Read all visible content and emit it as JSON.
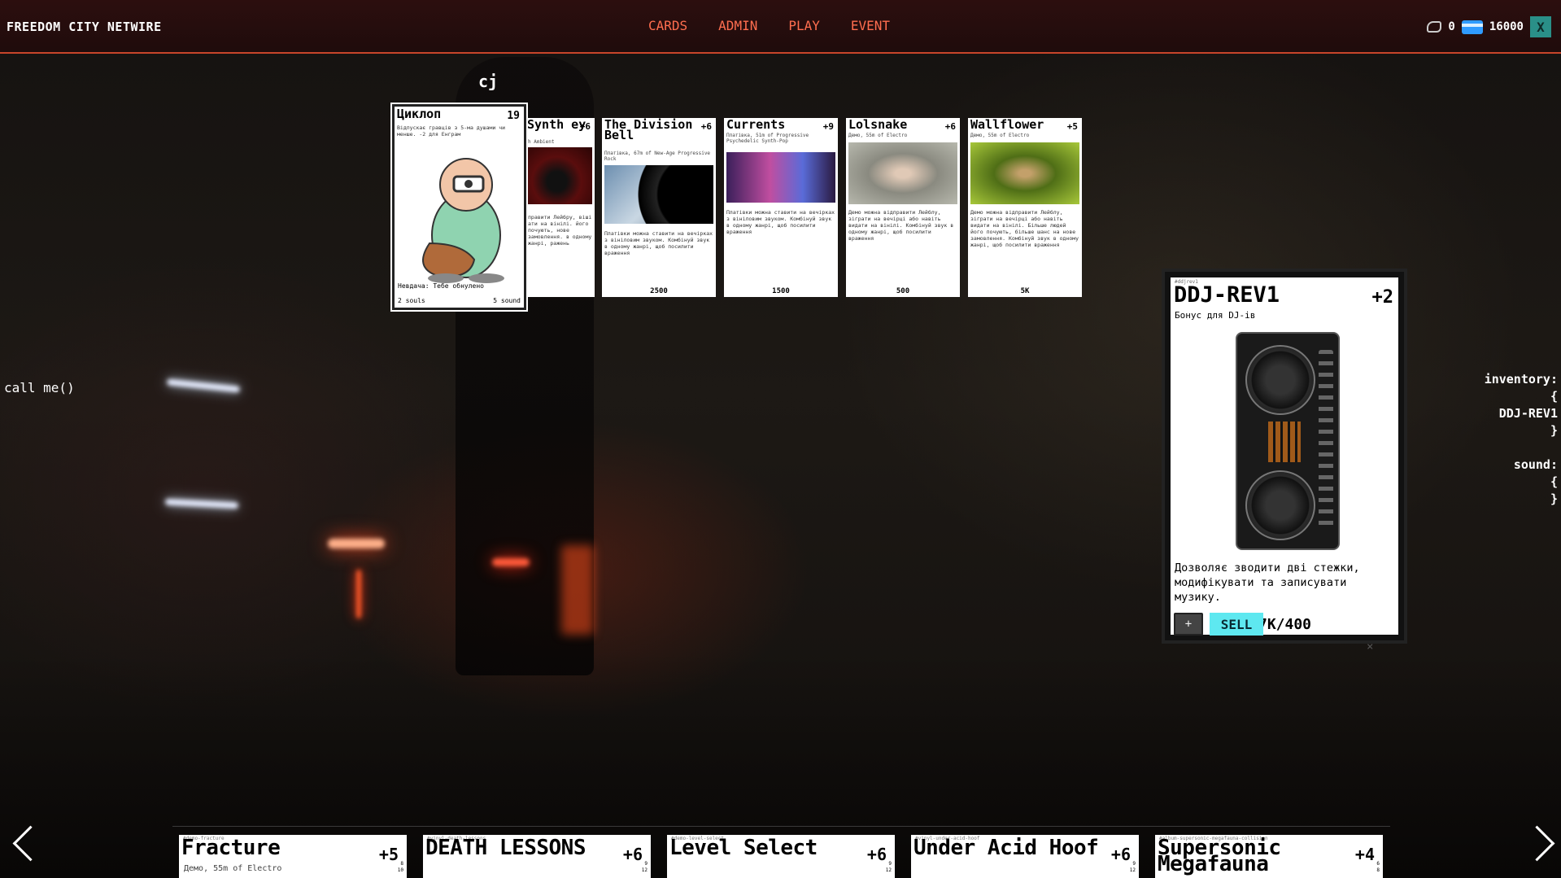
{
  "header": {
    "brand": "FREEDOM CITY NETWIRE",
    "nav": [
      "CARDS",
      "ADMIN",
      "PLAY",
      "EVENT"
    ],
    "hand_count": "0",
    "credits": "16000",
    "close_label": "X"
  },
  "player": {
    "name": "cj"
  },
  "hand": [
    {
      "title": "Циклоп",
      "power": "19",
      "desc": "Відпускає гравців з 5-ма душами чи менше. -2 для Енграм",
      "note": "Невдача: Тебе обнулено",
      "souls": "2 souls",
      "sound": "5 sound"
    },
    {
      "title": "Synth ey",
      "power": "+6",
      "sub": "h Ambient",
      "desc": "правити Лейбру, віші ати на вінілі. його почують, нове замовлення. в одному жанрі, ражень",
      "price": ""
    },
    {
      "title": "The Division Bell",
      "power": "+6",
      "sub": "Платівка, 67m of New-Age Progressive Rock",
      "desc": "Платівки можна ставити на вечірках з вініловим звуком. Комбінуй звук в одному жанрі, щоб посилити враження",
      "price": "2500"
    },
    {
      "title": "Currents",
      "power": "+9",
      "sub": "Платівка, 51m of Progressive Psychedelic Synth-Pop",
      "desc": "Платівки можна ставити на вечірках з вініловим звуком. Комбінуй звук в одному жанрі, щоб посилити враження",
      "price": "1500"
    },
    {
      "title": "Lolsnake",
      "power": "+6",
      "sub": "Демо, 55m of Electro",
      "desc": "Демо можна відправити Лейблу, зіграти на вечірці або навіть видати на вінілі. Комбінуй звук в одному жанрі, щоб посилити враження",
      "price": "500"
    },
    {
      "title": "Wallflower",
      "power": "+5",
      "sub": "Демо, 55m of Electro",
      "desc": "Демо можна відправити Лейблу, зіграти на вечірці або навіть видати на вінілі. Більше людей його почують, більше шанс на нове замовлення. Комбінуй звук в одному жанрі, щоб посилити враження",
      "price": "5K"
    }
  ],
  "selected": {
    "tag": "#ddjrev1",
    "title": "DDJ-REV1",
    "power": "+2",
    "sub": "Бонус для DJ-ів",
    "desc": "Дозволяє зводити дві стежки, модифікувати та записувати музику.",
    "plus_label": "+",
    "sell_label": "SELL",
    "count": "7K/400",
    "dismiss": "×"
  },
  "left_text": "call me()",
  "state": {
    "inventory_label": "inventory:",
    "open": "{",
    "item": "DDJ-REV1",
    "close": "}",
    "sound_label": "sound:",
    "sound_open": "{",
    "sound_close": "}"
  },
  "deck": [
    {
      "tag": "#demo-fracture",
      "title": "Fracture",
      "power": "+5",
      "sub": "Демо, 55m of Electro",
      "n1": "8",
      "n2": "10"
    },
    {
      "tag": "#vinyl-death-lessons",
      "title": "DEATH LESSONS",
      "power": "+6",
      "sub": "",
      "n1": "9",
      "n2": "12"
    },
    {
      "tag": "#demo-level-select",
      "title": "Level Select",
      "power": "+6",
      "sub": "",
      "n1": "9",
      "n2": "12"
    },
    {
      "tag": "#vinyl-under-acid-hoof",
      "title": "Under Acid Hoof",
      "power": "+6",
      "sub": "",
      "n1": "9",
      "n2": "12"
    },
    {
      "tag": "#album-supersonic-megafauna-collision",
      "title": "Supersonic Megafauna",
      "power": "+4",
      "sub": "",
      "n1": "6",
      "n2": "8"
    }
  ],
  "colors": {
    "nav": "#ff6e4f",
    "accent_line": "#c8452a",
    "sell": "#5ee8f0",
    "credit_icon": "#2f9bff",
    "close_bg": "#2a8f88"
  }
}
